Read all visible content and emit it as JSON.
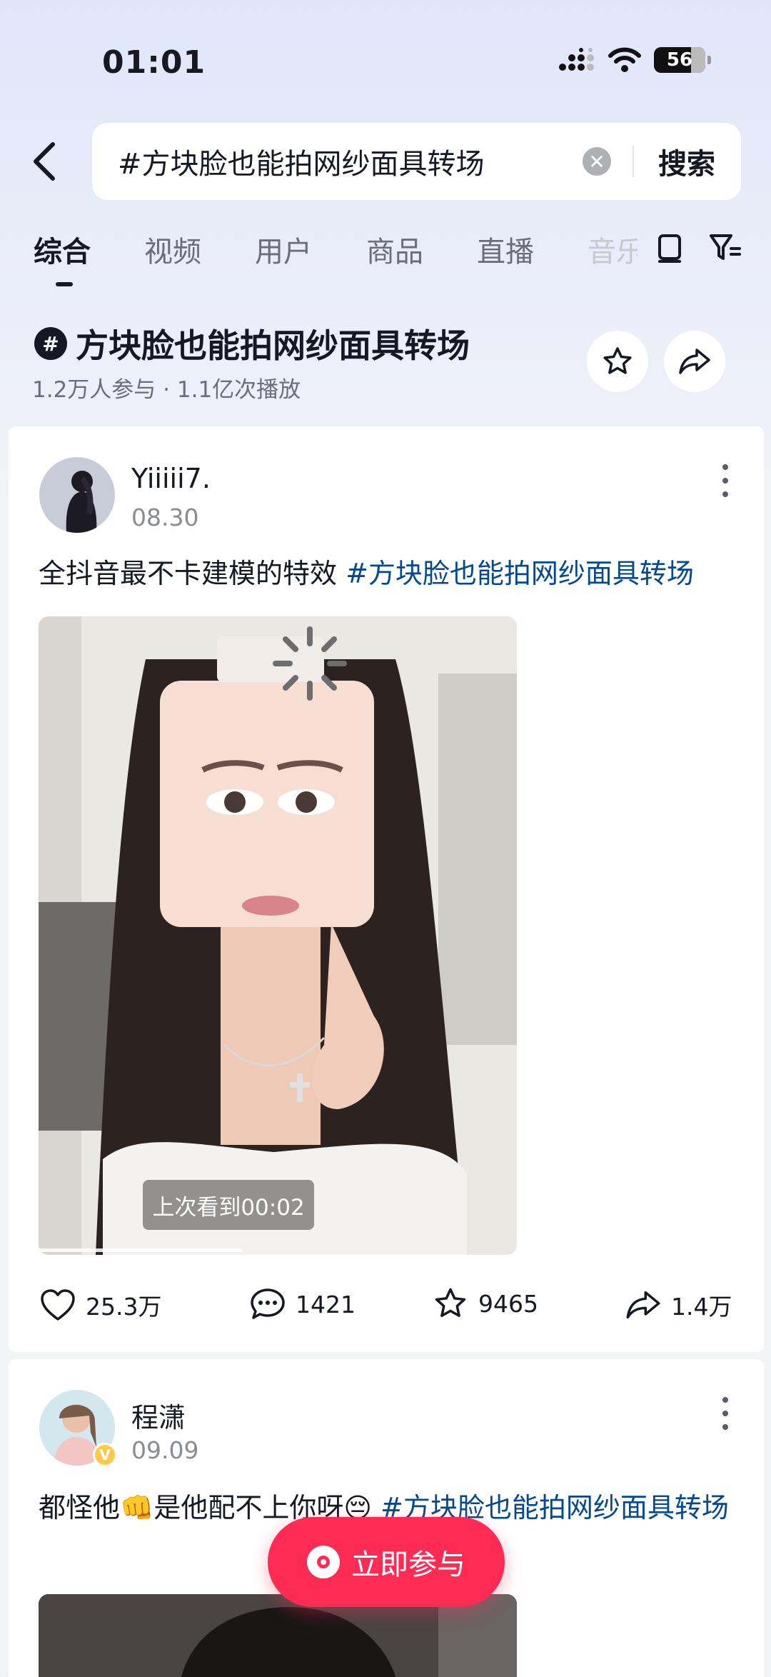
{
  "status_bar": {
    "time": "01:01",
    "battery": "56"
  },
  "search": {
    "query": "#方块脸也能拍网纱面具转场",
    "button_label": "搜索"
  },
  "tabs": [
    {
      "label": "综合",
      "active": true
    },
    {
      "label": "视频"
    },
    {
      "label": "用户"
    },
    {
      "label": "商品"
    },
    {
      "label": "直播"
    },
    {
      "label": "音乐"
    }
  ],
  "topic": {
    "hash_symbol": "#",
    "title": "方块脸也能拍网纱面具转场",
    "meta": "1.2万人参与 · 1.1亿次播放"
  },
  "posts": [
    {
      "username": "Yiiiii7.",
      "date": "08.30",
      "caption_text": "全抖音最不卡建模的特效 ",
      "caption_tag": "#方块脸也能拍网纱面具转场",
      "resume_label": "上次看到00:02",
      "likes": "25.3万",
      "comments": "1421",
      "favorites": "9465",
      "shares": "1.4万"
    },
    {
      "username": "程潇",
      "date": "09.09",
      "caption_text": "都怪他👊是他配不上你呀😔 ",
      "caption_tag": "#方块脸也能拍网纱面具转场"
    }
  ],
  "join_button": {
    "label": "立即参与"
  },
  "colors": {
    "accent": "#fe2c55",
    "tag_blue": "#04498d"
  }
}
